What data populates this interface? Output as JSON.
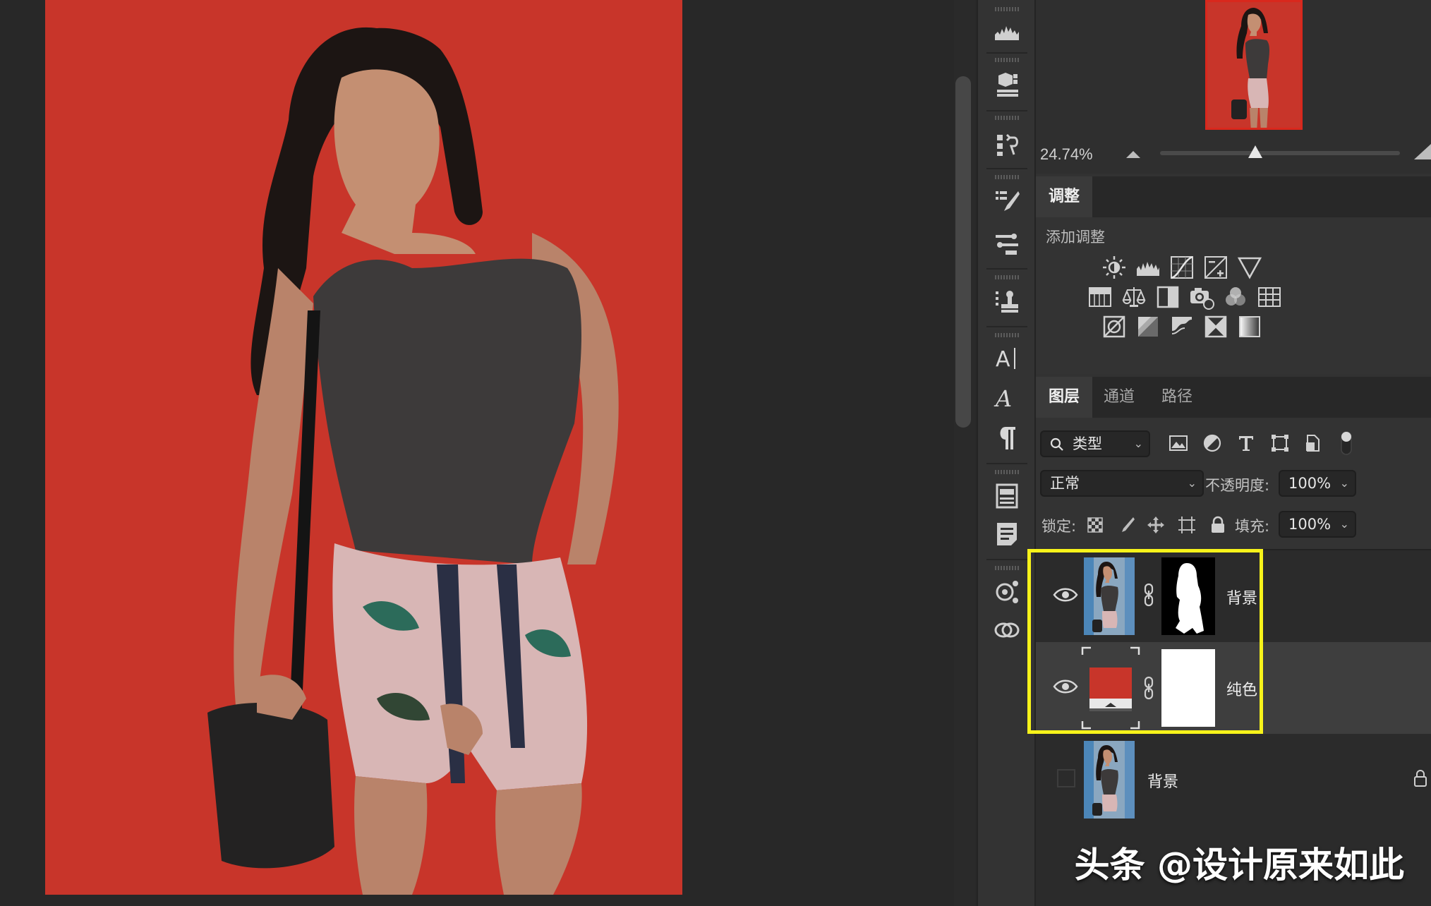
{
  "colors": {
    "fill_color_layer": "#c8352a",
    "highlight": "#f7f31a",
    "panel_bg": "#333333"
  },
  "navigator": {
    "zoom": "24.74%"
  },
  "adjustments": {
    "tab": "调整",
    "subtitle": "添加调整",
    "rows": [
      [
        "brightness-contrast-icon",
        "levels-icon",
        "curves-icon",
        "exposure-icon",
        "vibrance-icon"
      ],
      [
        "hue-saturation-icon",
        "color-balance-icon",
        "black-white-icon",
        "photo-filter-icon",
        "channel-mixer-icon",
        "color-lookup-icon"
      ],
      [
        "invert-icon",
        "posterize-icon",
        "threshold-icon",
        "selective-color-icon",
        "gradient-map-icon"
      ]
    ]
  },
  "layers_panel": {
    "tabs": [
      "图层",
      "通道",
      "路径"
    ],
    "filter_label": "类型",
    "blend_mode": "正常",
    "opacity_label": "不透明度:",
    "opacity_value": "100%",
    "lock_label": "锁定:",
    "fill_label": "填充:",
    "fill_value": "100%",
    "layers": [
      {
        "name": "背景",
        "visible": true,
        "has_mask": true,
        "type": "pixel"
      },
      {
        "name": "纯色",
        "visible": true,
        "has_mask": true,
        "type": "solid-color",
        "selected": true
      },
      {
        "name": "背景",
        "visible": false,
        "has_mask": false,
        "type": "background",
        "locked": true
      }
    ]
  },
  "watermark": "头条 @设计原来如此"
}
